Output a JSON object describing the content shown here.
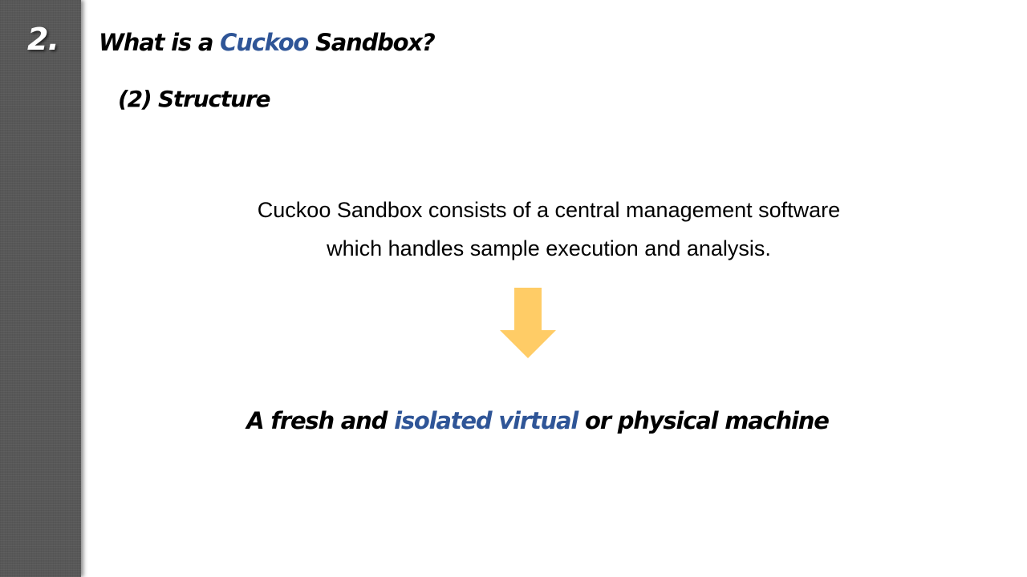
{
  "sidebar": {
    "section_number": "2.",
    "color": "#585858"
  },
  "header": {
    "title_prefix": "What is a ",
    "title_accent": "Cuckoo",
    "title_suffix": " Sandbox?",
    "subtitle": "(2) Structure"
  },
  "content": {
    "line1": "Cuckoo Sandbox consists of a central management software",
    "line2": "which handles sample execution and analysis.",
    "arrow_icon": "down-arrow-icon",
    "arrow_color": "#ffcc66",
    "conclusion_prefix": "A fresh and ",
    "conclusion_accent": "isolated virtual",
    "conclusion_suffix": " or physical machine"
  },
  "colors": {
    "accent": "#2f5597",
    "text": "#000000",
    "background": "#ffffff"
  }
}
